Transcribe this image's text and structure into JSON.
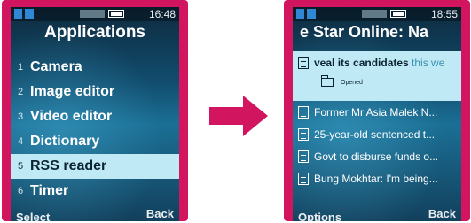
{
  "left_screen": {
    "time": "16:48",
    "title": "Applications",
    "menu": [
      {
        "num": "1",
        "label": "Camera"
      },
      {
        "num": "2",
        "label": "Image editor"
      },
      {
        "num": "3",
        "label": "Video editor"
      },
      {
        "num": "4",
        "label": "Dictionary"
      },
      {
        "num": "5",
        "label": "RSS reader"
      },
      {
        "num": "6",
        "label": "Timer"
      }
    ],
    "selected_index": 4,
    "softkeys": {
      "left": "Select",
      "right": "Back"
    }
  },
  "right_screen": {
    "time": "18:55",
    "title": "e Star Online: Na",
    "selected_item": {
      "bold_text": "veal its candidates",
      "rest_text": " this we",
      "status": "Opened"
    },
    "items": [
      "Former Mr Asia Malek N...",
      "25-year-old sentenced t...",
      "Govt to disburse funds o...",
      "Bung Mokhtar: I'm being..."
    ],
    "softkeys": {
      "left": "Options",
      "right": "Back"
    }
  },
  "colors": {
    "frame": "#d1155e",
    "highlight": "#bfeaf5",
    "arrow": "#d1155e"
  },
  "icons": [
    "signal-icon",
    "battery-icon",
    "feed-item-icon",
    "folder-icon"
  ]
}
